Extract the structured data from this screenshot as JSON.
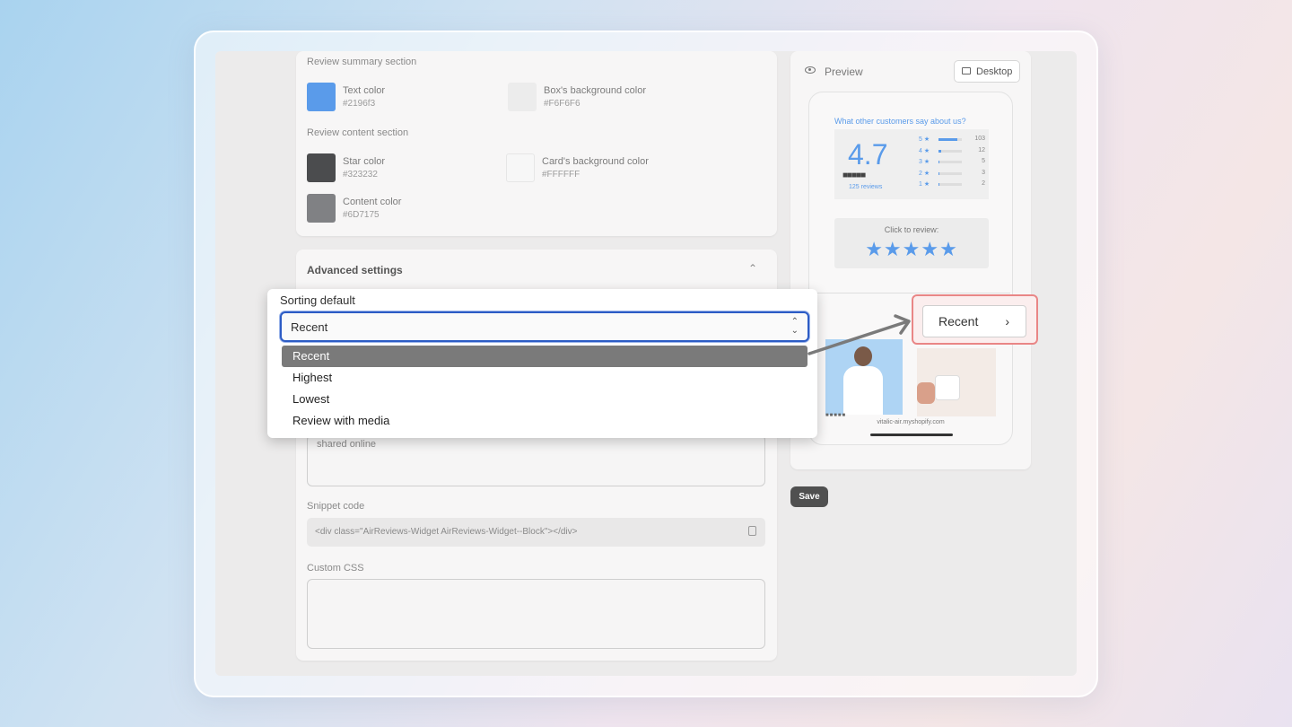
{
  "settings": {
    "summary_heading": "Review summary section",
    "text_color": {
      "name": "Text color",
      "hex": "#2196f3",
      "swatch": "#5a9bea"
    },
    "box_bg": {
      "name": "Box's background color",
      "hex": "#F6F6F6",
      "swatch": "#efefef"
    },
    "content_heading": "Review content section",
    "star_color": {
      "name": "Star color",
      "hex": "#323232",
      "swatch": "#4b4c4e"
    },
    "card_bg": {
      "name": "Card's background color",
      "hex": "#FFFFFF",
      "swatch": "#f7f7f7"
    },
    "content_color": {
      "name": "Content color",
      "hex": "#6D7175",
      "swatch": "#808184"
    }
  },
  "advanced": {
    "title": "Advanced settings",
    "sorting_label": "Sorting default",
    "sorting_value": "Recent",
    "options": [
      "Recent",
      "Highest",
      "Lowest",
      "Review with media"
    ],
    "textarea_text": "shared online",
    "snippet_label": "Snippet code",
    "snippet_value": "<div class=\"AirReviews-Widget AirReviews-Widget--Block\"></div>",
    "css_label": "Custom CSS"
  },
  "preview": {
    "title": "Preview",
    "device_button": "Desktop",
    "widget_heading": "What other customers say about us?",
    "rating": "4.7",
    "reviews_count": "125 reviews",
    "bars": [
      {
        "label": "5 ★",
        "count": "103",
        "fill": 0.82
      },
      {
        "label": "4 ★",
        "count": "12",
        "fill": 0.1
      },
      {
        "label": "3 ★",
        "count": "5",
        "fill": 0.05
      },
      {
        "label": "2 ★",
        "count": "3",
        "fill": 0.03
      },
      {
        "label": "1 ★",
        "count": "2",
        "fill": 0.02
      }
    ],
    "click_to_review": "Click to review:",
    "stars": "★★★★★",
    "domain": "vitalic-air.myshopify.com",
    "recent_button": "Recent",
    "accent": "#5a9bea"
  },
  "footer": {
    "save_label": "Save"
  }
}
